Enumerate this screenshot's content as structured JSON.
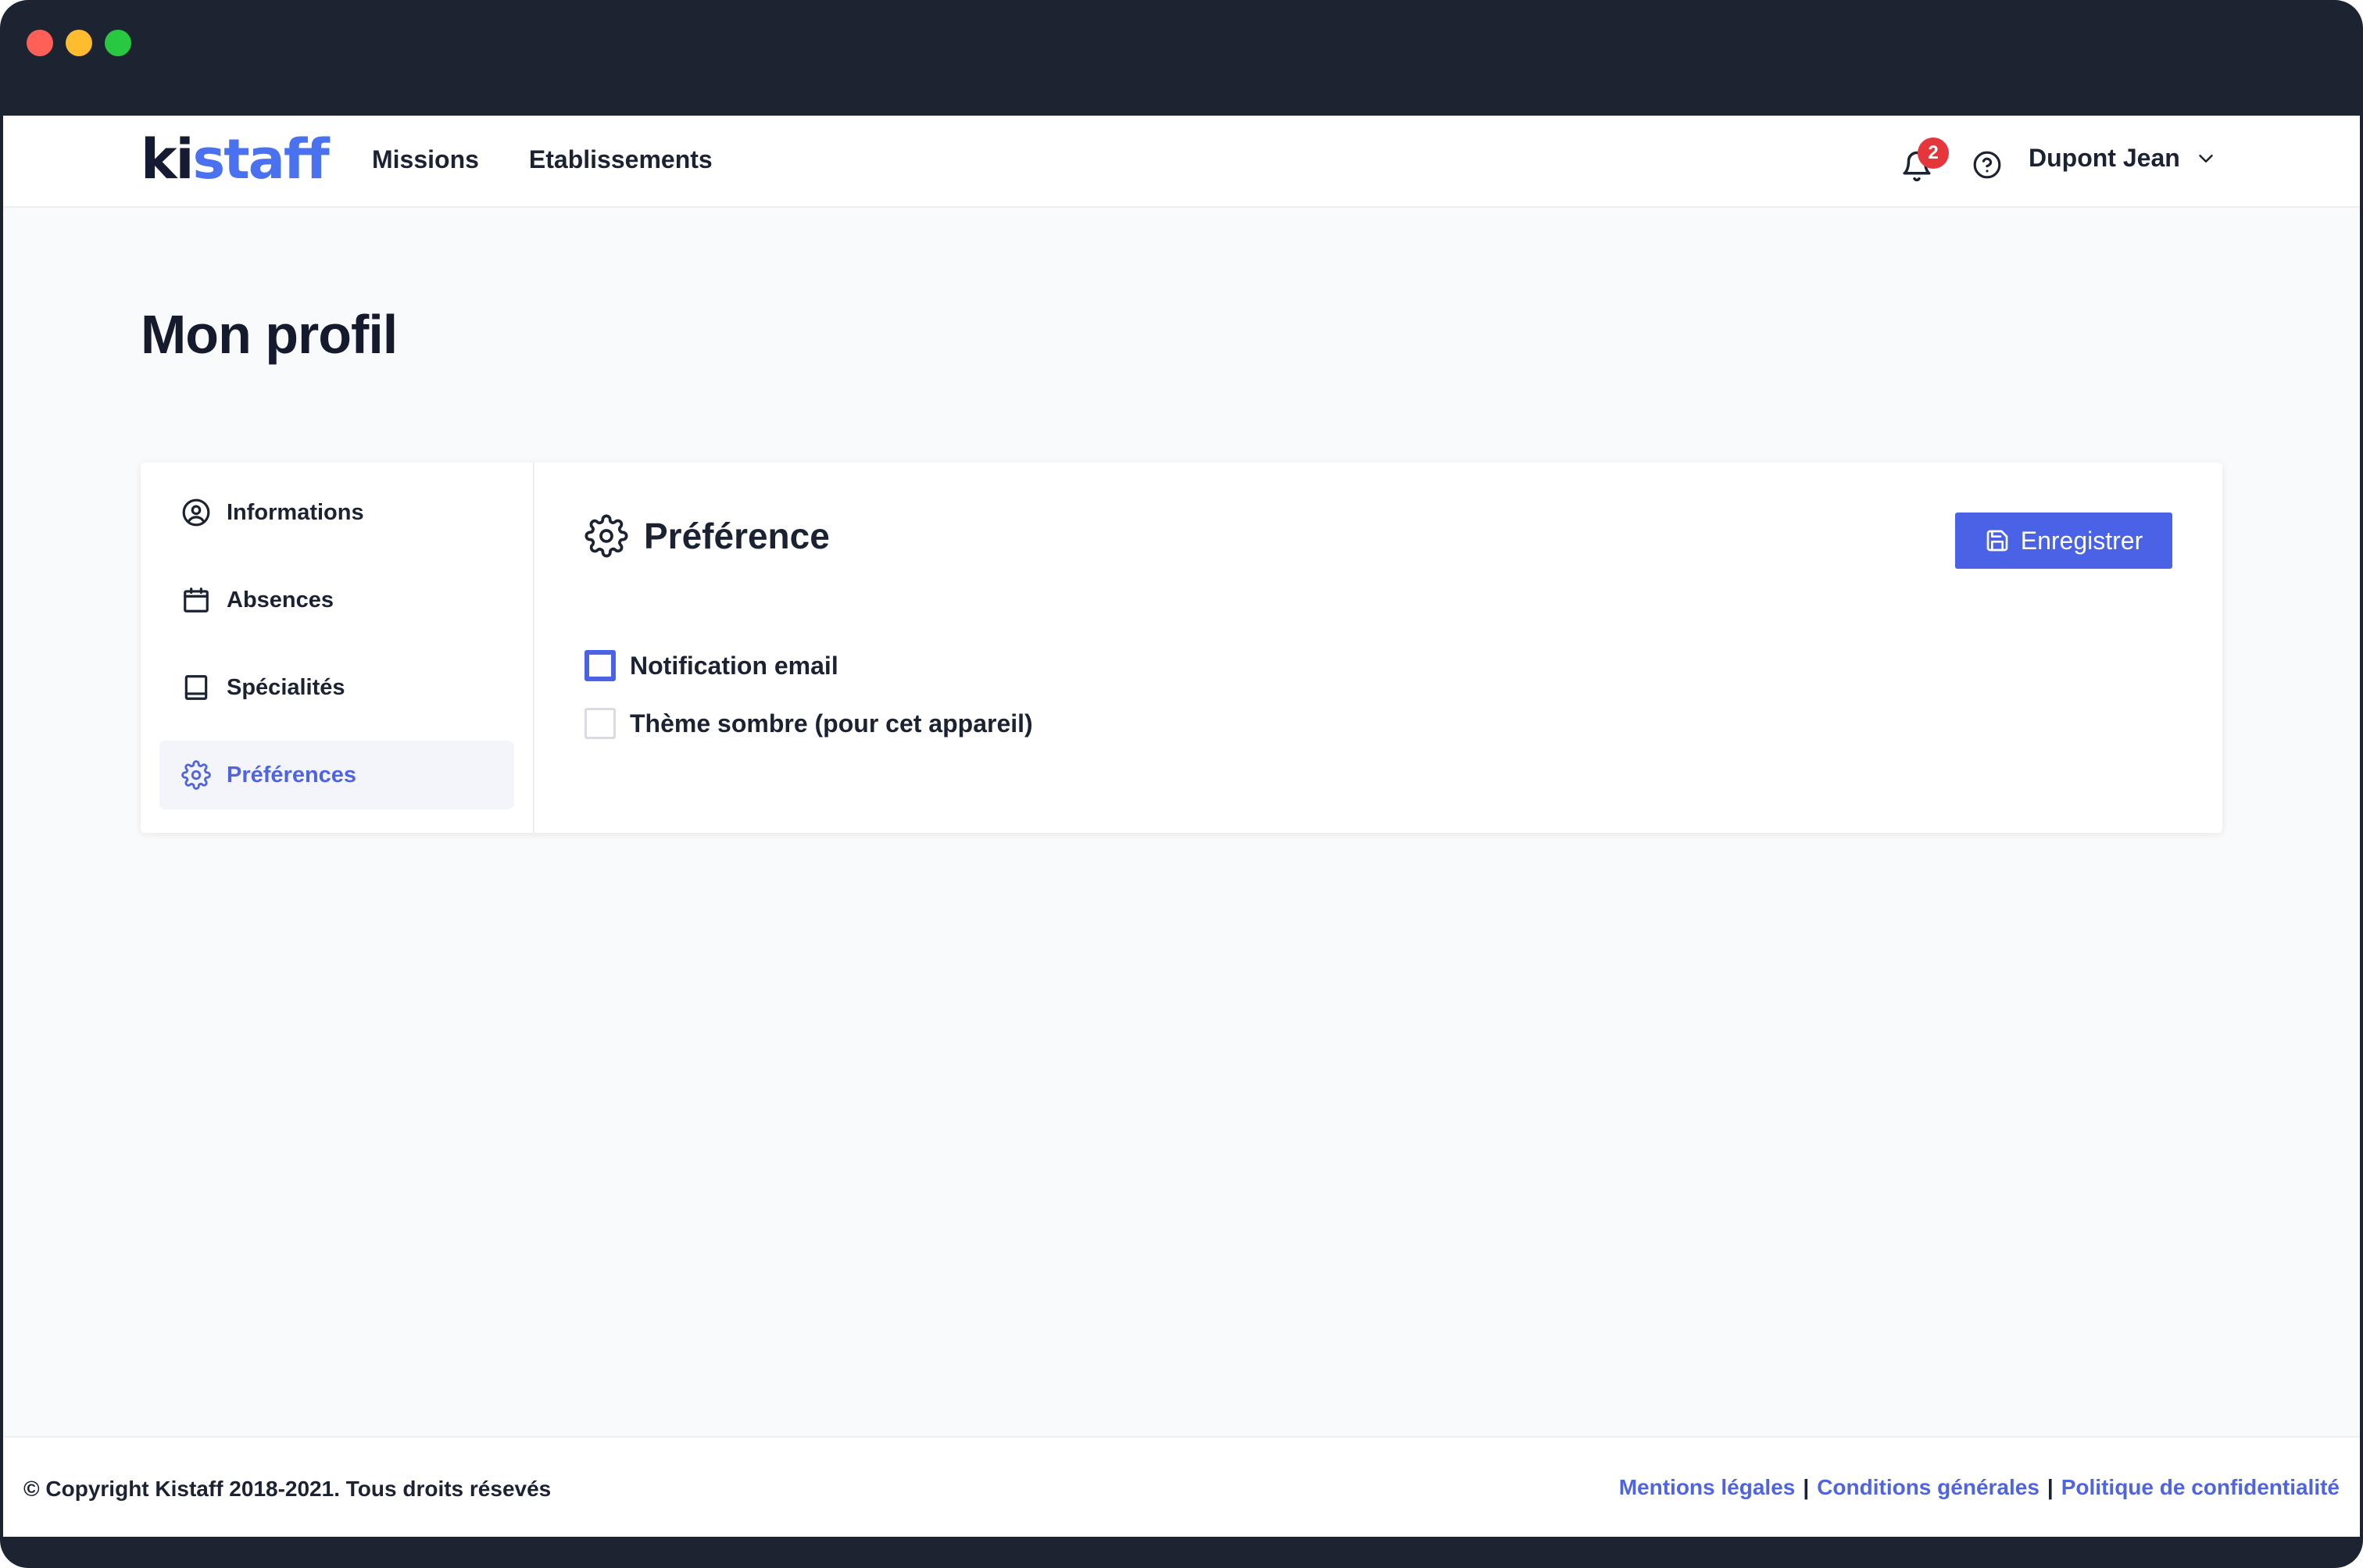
{
  "header": {
    "logo_part1": "ki",
    "logo_part2": "staff",
    "nav": [
      "Missions",
      "Etablissements"
    ],
    "notification_count": "2",
    "user_name": "Dupont Jean"
  },
  "page": {
    "title": "Mon profil"
  },
  "sidebar": {
    "items": [
      {
        "label": "Informations",
        "icon": "user-circle-icon"
      },
      {
        "label": "Absences",
        "icon": "calendar-icon"
      },
      {
        "label": "Spécialités",
        "icon": "book-icon"
      },
      {
        "label": "Préférences",
        "icon": "gear-icon",
        "active": true
      }
    ]
  },
  "section": {
    "title": "Préférence",
    "save_label": "Enregistrer",
    "options": [
      {
        "label": "Notification email",
        "checked": false,
        "focused": true
      },
      {
        "label": "Thème sombre (pour cet appareil)",
        "checked": false,
        "focused": false
      }
    ]
  },
  "footer": {
    "copyright": "© Copyright Kistaff 2018-2021. Tous droits résevés",
    "links": [
      "Mentions légales",
      "Conditions générales",
      "Politique de confidentialité"
    ],
    "separator": "|"
  },
  "colors": {
    "accent": "#4a62e6",
    "logo_blue": "#4a72f0",
    "badge_red": "#e5363b",
    "chrome": "#1b2430"
  }
}
